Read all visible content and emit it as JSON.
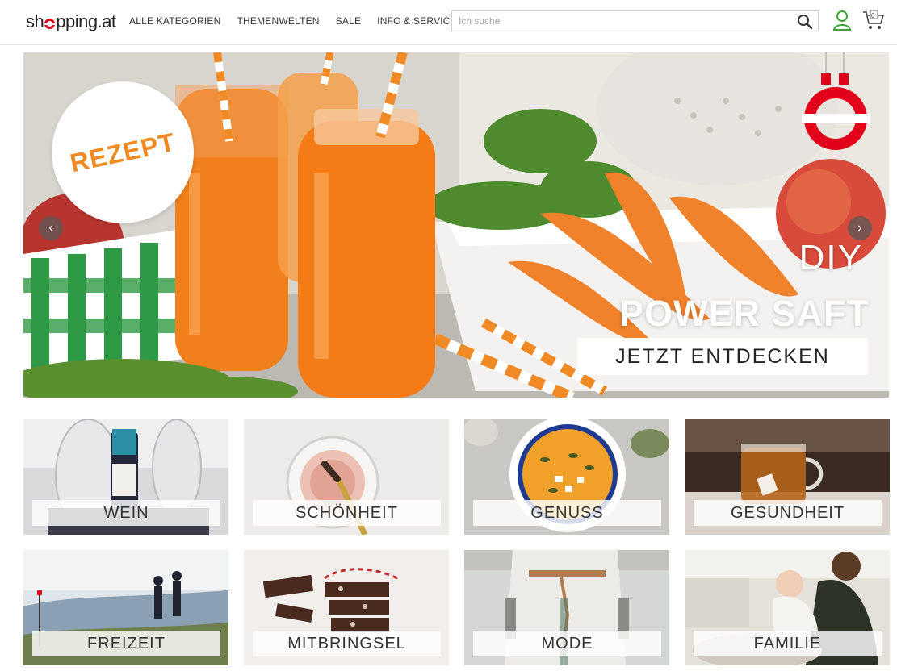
{
  "header": {
    "logo_text": "shopping.at",
    "nav": [
      {
        "label": "ALLE KATEGORIEN"
      },
      {
        "label": "THEMENWELTEN"
      },
      {
        "label": "SALE"
      },
      {
        "label": "INFO & SERVICE"
      }
    ],
    "search": {
      "placeholder": "Ich suche",
      "value": ""
    },
    "icons": {
      "search": "search-icon",
      "user": "user-icon",
      "cart": "cart-icon"
    },
    "cart_count": "0",
    "brand_color": "#e2001a"
  },
  "hero": {
    "badge": "REZEPT",
    "title_small": "DIY",
    "title_big": "POWER SAFT",
    "cta": "JETZT ENTDECKEN",
    "arrow_left": "‹",
    "arrow_right": "›",
    "accent_color": "#f28a22"
  },
  "categories": [
    {
      "label": "WEIN"
    },
    {
      "label": "SCHÖNHEIT"
    },
    {
      "label": "GENUSS"
    },
    {
      "label": "GESUNDHEIT"
    },
    {
      "label": "FREIZEIT"
    },
    {
      "label": "MITBRINGSEL"
    },
    {
      "label": "MODE"
    },
    {
      "label": "FAMILIE"
    }
  ]
}
